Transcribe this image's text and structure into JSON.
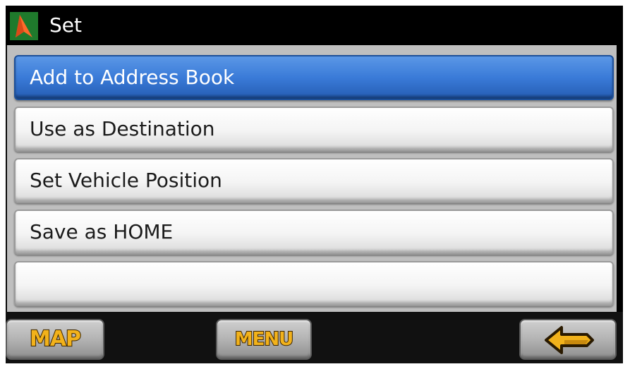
{
  "window": {
    "title": "Set"
  },
  "list": {
    "items": [
      {
        "label": "Add to Address Book",
        "selected": true
      },
      {
        "label": "Use as Destination",
        "selected": false
      },
      {
        "label": "Set Vehicle Position",
        "selected": false
      },
      {
        "label": "Save as HOME",
        "selected": false
      },
      {
        "label": "",
        "selected": false
      }
    ]
  },
  "toolbar": {
    "map_label": "MAP",
    "menu_label": "MENU",
    "back_icon": "back-arrow-icon"
  },
  "colors": {
    "selected": "#3a7bd8",
    "button_text": "#f2b21b",
    "titlebar": "#000000"
  }
}
